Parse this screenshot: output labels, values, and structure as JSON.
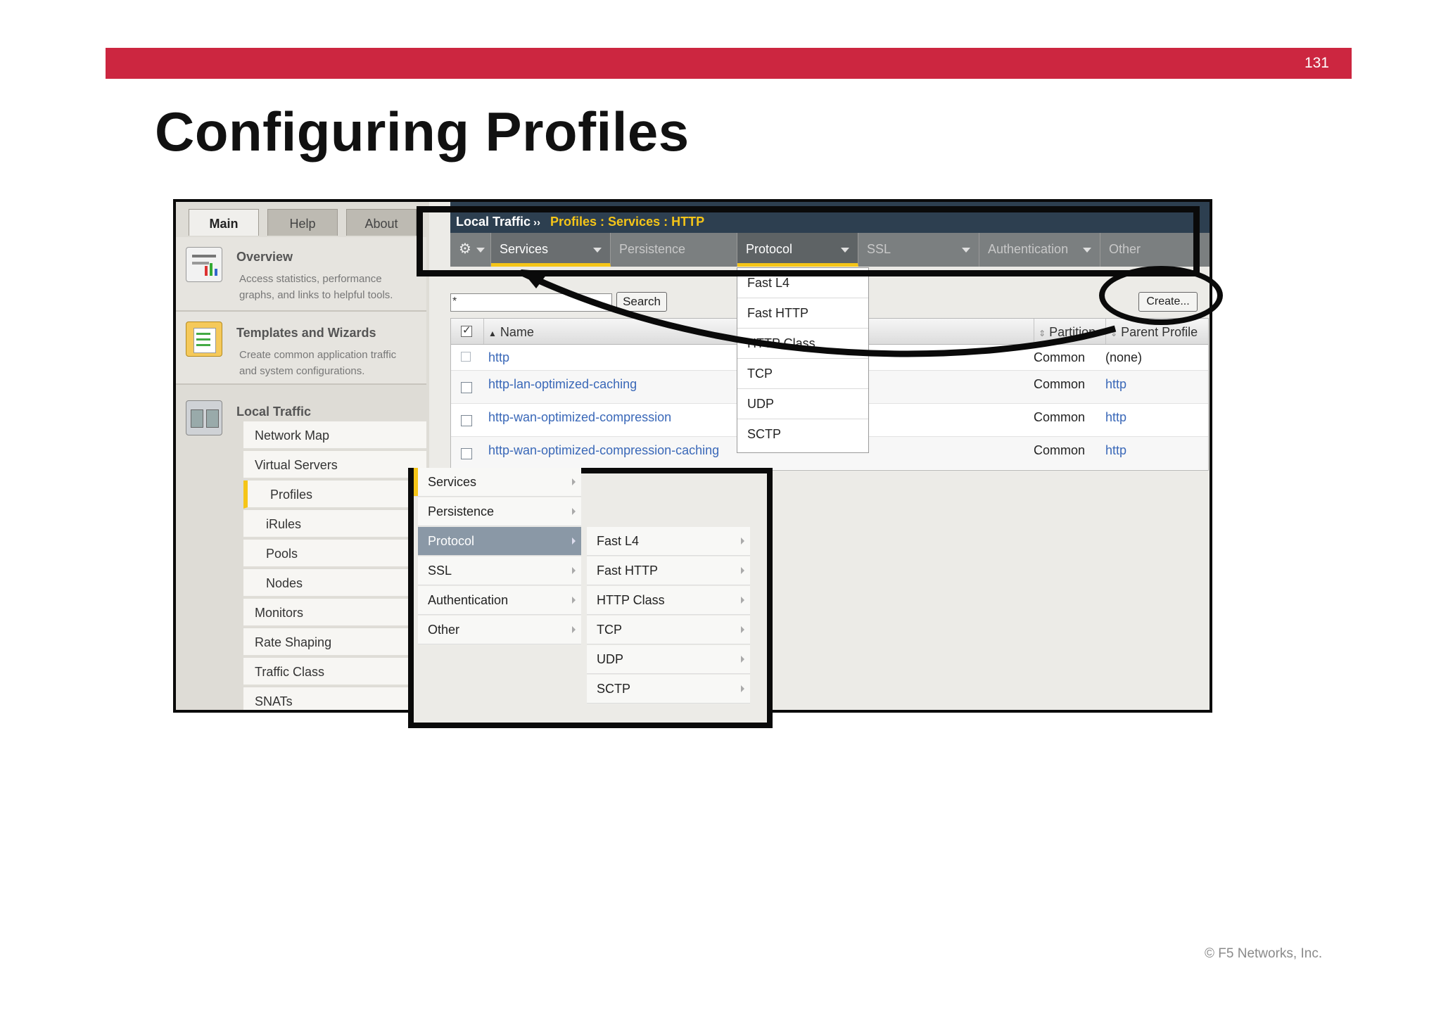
{
  "slide": {
    "number": "131",
    "title": "Configuring Profiles",
    "copyright": "© F5 Networks, Inc."
  },
  "left_panel": {
    "tabs": [
      "Main",
      "Help",
      "About"
    ],
    "overview": {
      "title": "Overview",
      "desc_line1": "Access statistics, performance",
      "desc_line2": "graphs, and links to helpful tools."
    },
    "templates": {
      "title": "Templates and Wizards",
      "desc_line1": "Create common application traffic",
      "desc_line2": "and system configurations."
    },
    "local_traffic": {
      "title": "Local Traffic",
      "items": [
        "Network Map",
        "Virtual Servers",
        "Profiles",
        "iRules",
        "Pools",
        "Nodes",
        "Monitors",
        "Rate Shaping",
        "Traffic Class",
        "SNATs"
      ]
    }
  },
  "header": {
    "breadcrumb_root": "Local Traffic",
    "breadcrumb_sep": "››",
    "breadcrumb_path": "Profiles : Services : HTTP",
    "nav": [
      "Services",
      "Persistence",
      "Protocol",
      "SSL",
      "Authentication",
      "Other"
    ]
  },
  "search": {
    "value": "*",
    "button": "Search"
  },
  "create_button": "Create...",
  "table": {
    "columns": {
      "name": "Name",
      "partition": "Partition",
      "parent": "Parent Profile"
    },
    "rows": [
      {
        "name": "http",
        "partition": "Common",
        "parent": "(none)"
      },
      {
        "name": "http-lan-optimized-caching",
        "partition": "Common",
        "parent": "http"
      },
      {
        "name": "http-wan-optimized-compression",
        "partition": "Common",
        "parent": "http"
      },
      {
        "name": "http-wan-optimized-compression-caching",
        "partition": "Common",
        "parent": "http"
      }
    ]
  },
  "protocol_dropdown": [
    "Fast L4",
    "Fast HTTP",
    "HTTP Class",
    "TCP",
    "UDP",
    "SCTP"
  ],
  "cascade_menu": {
    "level1": [
      "Services",
      "Persistence",
      "Protocol",
      "SSL",
      "Authentication",
      "Other"
    ],
    "level2": [
      "Fast L4",
      "Fast HTTP",
      "HTTP Class",
      "TCP",
      "UDP",
      "SCTP"
    ]
  },
  "colors": {
    "banner": "#cc2640",
    "accent_yellow": "#f5c518",
    "header_dark": "#2d3f50",
    "nav_gray": "#7b7f80",
    "link_blue": "#3a68b8"
  }
}
